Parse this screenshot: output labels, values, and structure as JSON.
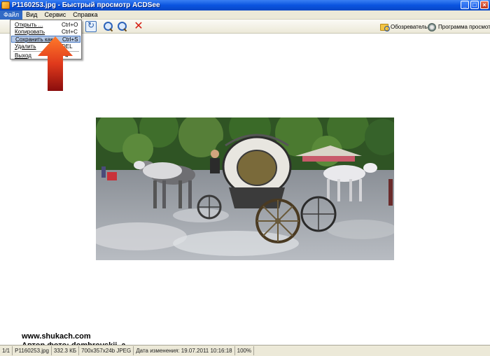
{
  "window": {
    "title": "P1160253.jpg - Быстрый просмотр ACDSee"
  },
  "menubar": {
    "items": [
      "Файл",
      "Вид",
      "Сервис",
      "Справка"
    ]
  },
  "file_menu": {
    "items": [
      {
        "label": "Открыть ...",
        "shortcut": "Ctrl+O"
      },
      {
        "label": "Копировать",
        "shortcut": "Ctrl+C"
      },
      {
        "label": "Сохранить как ...",
        "shortcut": "Ctrl+S",
        "highlighted": true
      },
      {
        "label": "Удалить",
        "shortcut": "DEL"
      },
      {
        "label": "Выход",
        "shortcut": "F4"
      }
    ]
  },
  "toolbar": {
    "icons": [
      "rotate-icon",
      "zoom-in-icon",
      "zoom-out-icon",
      "delete-icon"
    ],
    "browser_label": "Обозреватель",
    "viewer_label": "Программа просмотра"
  },
  "watermark": {
    "url": "www.shukach.com",
    "author": "Автор фото: dombrovskii_a"
  },
  "statusbar": {
    "cells": [
      "1/1",
      "P1160253.jpg",
      "332.3 КБ",
      "700x357x24b JPEG",
      "Дата изменения: 19.07.2011 10:16:18",
      "100%"
    ]
  },
  "colors": {
    "titlebar": "#0a54e0",
    "menu_highlight": "#316ac5",
    "arrow": "#e0341a"
  }
}
